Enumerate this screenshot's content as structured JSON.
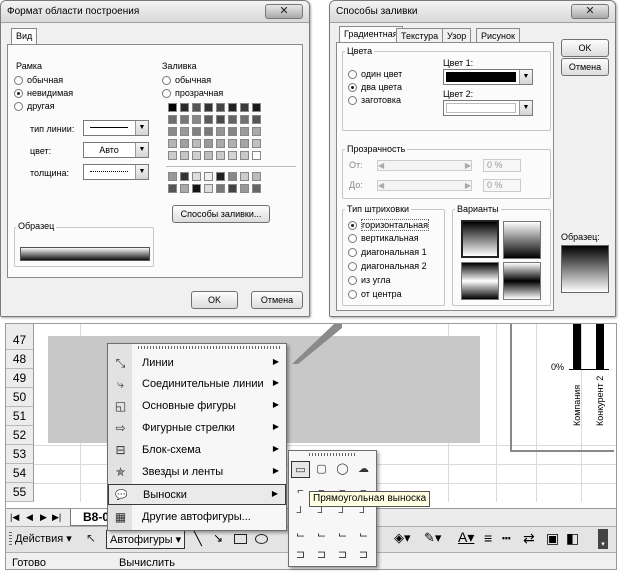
{
  "dialog_left": {
    "title": "Формат области построения",
    "close_glyph": "✕",
    "tab": "Вид",
    "frame": {
      "label": "Рамка",
      "options": [
        "обычная",
        "невидимая",
        "другая"
      ],
      "selected": "невидимая",
      "line_type_label": "тип линии:",
      "color_label": "цвет:",
      "color_value": "Авто",
      "thickness_label": "толщина:"
    },
    "fill": {
      "label": "Заливка",
      "options": [
        "обычная",
        "прозрачная"
      ],
      "fill_effects_button": "Способы заливки..."
    },
    "sample_label": "Образец",
    "ok": "OK",
    "cancel": "Отмена"
  },
  "dialog_right": {
    "title": "Способы заливки",
    "close_glyph": "✕",
    "tabs": [
      "Градиентная",
      "Текстура",
      "Узор",
      "Рисунок"
    ],
    "active_tab": "Градиентная",
    "colors": {
      "label": "Цвета",
      "options": [
        "один цвет",
        "два цвета",
        "заготовка"
      ],
      "selected": "два цвета",
      "color1_label": "Цвет 1:",
      "color2_label": "Цвет 2:"
    },
    "transparency": {
      "label": "Прозрачность",
      "from_label": "От:",
      "to_label": "До:",
      "from_value": "0 %",
      "to_value": "0 %"
    },
    "shading": {
      "label": "Тип штриховки",
      "options": [
        "горизонтальная",
        "вертикальная",
        "диагональная 1",
        "диагональная 2",
        "из угла",
        "от центра"
      ],
      "selected": "горизонтальная"
    },
    "variants_label": "Варианты",
    "sample_label": "Образец:",
    "ok": "OK",
    "cancel": "Отмена"
  },
  "sheet": {
    "rows": [
      "47",
      "48",
      "49",
      "50",
      "51",
      "52",
      "53",
      "54",
      "55"
    ],
    "sheet_tab": "В8-0",
    "chart": {
      "ytick": "0%",
      "categories": [
        "Компания",
        "Конкурент 2"
      ]
    }
  },
  "autoshapes_menu": {
    "items": [
      {
        "label": "Линии",
        "icon": "⤡",
        "sub": "▶"
      },
      {
        "label": "Соединительные линии",
        "icon": "⤷",
        "sub": "▶"
      },
      {
        "label": "Основные фигуры",
        "icon": "◱",
        "sub": "▶"
      },
      {
        "label": "Фигурные стрелки",
        "icon": "⇨",
        "sub": "▶"
      },
      {
        "label": "Блок-схема",
        "icon": "⊟",
        "sub": "▶"
      },
      {
        "label": "Звезды и ленты",
        "icon": "✯",
        "sub": "▶"
      },
      {
        "label": "Выноски",
        "icon": "💬",
        "sub": "▶"
      },
      {
        "label": "Другие автофигуры...",
        "icon": "▦",
        "sub": ""
      }
    ],
    "highlighted": "Выноски"
  },
  "callouts_tooltip": "Прямоугольная выноска",
  "toolbar": {
    "actions": "Действия ▾",
    "autoshapes": "Автофигуры ▾"
  },
  "status": {
    "ready": "Готово",
    "calc": "Вычислить"
  }
}
